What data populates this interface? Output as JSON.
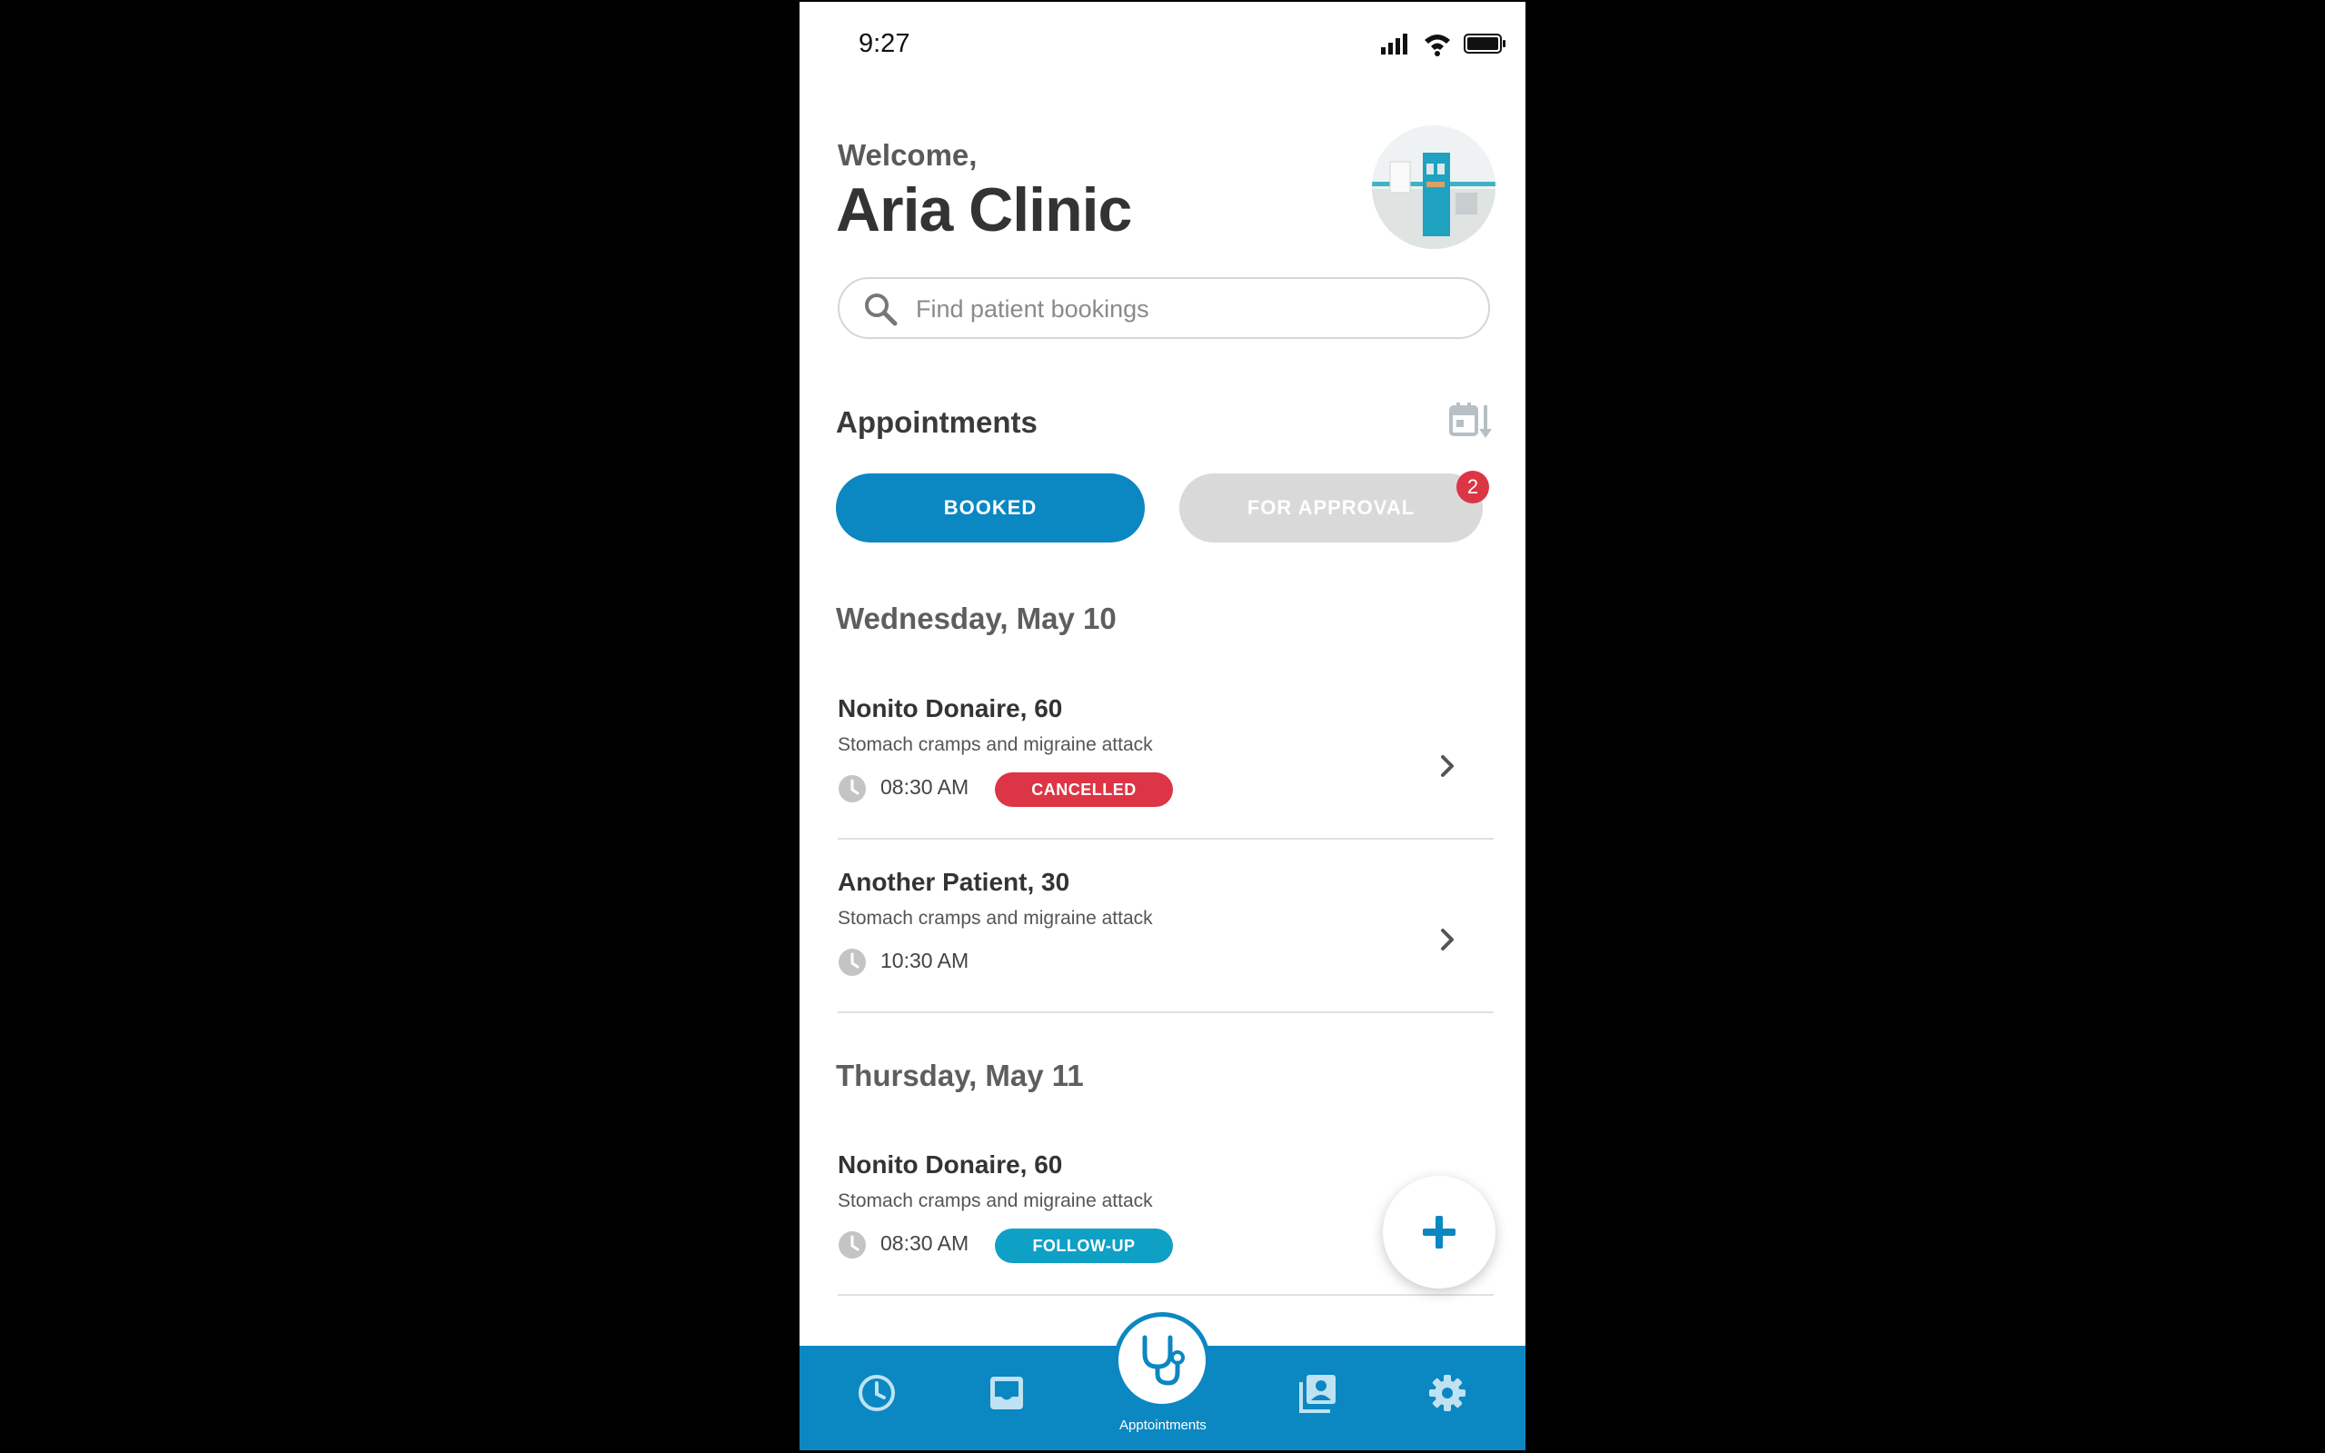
{
  "status_bar": {
    "time": "9:27"
  },
  "header": {
    "welcome": "Welcome,",
    "clinic_name": "Aria Clinic"
  },
  "search": {
    "placeholder": "Find patient bookings",
    "value": ""
  },
  "appointments": {
    "heading": "Appointments",
    "tabs": [
      {
        "label": "BOOKED",
        "active": true
      },
      {
        "label": "FOR APPROVAL",
        "active": false,
        "badge": "2"
      }
    ],
    "groups": [
      {
        "date": "Wednesday, May 10",
        "items": [
          {
            "name": "Nonito Donaire, 60",
            "desc": "Stomach cramps and migraine attack",
            "time": "08:30 AM",
            "status": "CANCELLED"
          },
          {
            "name": "Another Patient, 30",
            "desc": "Stomach cramps and migraine attack",
            "time": "10:30 AM",
            "status": ""
          }
        ]
      },
      {
        "date": "Thursday, May 11",
        "items": [
          {
            "name": "Nonito Donaire, 60",
            "desc": "Stomach cramps and migraine attack",
            "time": "08:30 AM",
            "status": "FOLLOW-UP"
          }
        ]
      }
    ]
  },
  "bottom_nav": {
    "active_label": "Apptointments",
    "items": [
      "clock-icon",
      "inbox-icon",
      "stethoscope-icon",
      "contacts-icon",
      "gear-icon"
    ]
  },
  "colors": {
    "primary": "#0b87c2",
    "cancelled": "#dc3545",
    "follow_up": "#0fa0c6",
    "inactive_tab": "#d9d9d9"
  }
}
